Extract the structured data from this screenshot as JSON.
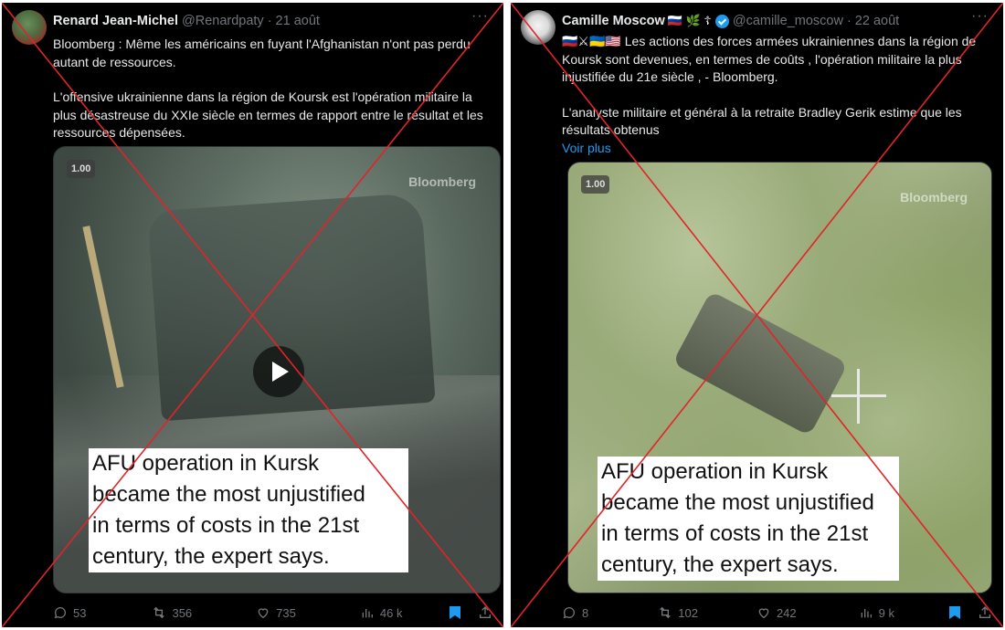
{
  "tweets": [
    {
      "author": "Renard Jean-Michel",
      "handle": "@Renardpaty",
      "separator": "·",
      "date": "21 août",
      "more": "···",
      "paragraph1": "Bloomberg : Même les américains en fuyant l'Afghanistan n'ont pas perdu autant de ressources.",
      "paragraph2": "L'offensive ukrainienne dans la région de Koursk est l'opération militaire la plus désastreuse du XXIe siècle en termes de rapport entre le résultat et les ressources dépensées.",
      "video": {
        "speed": "1.00",
        "watermark": "Bloomberg",
        "caption_lines": [
          "AFU operation in Kursk",
          "became the most unjustified",
          "in terms of costs in the 21st",
          "century, the expert says."
        ]
      },
      "stats": {
        "replies": "53",
        "reposts": "356",
        "likes": "735",
        "views": "46 k"
      }
    },
    {
      "author": "Camille Moscow",
      "name_emojis": "🇷🇺 🌿 ☦",
      "handle": "@camille_moscow",
      "separator": "·",
      "date": "22 août",
      "more": "···",
      "flags": "🇷🇺⚔🇺🇦🇺🇸",
      "paragraph1": "Les actions des forces armées ukrainiennes dans la région de Koursk sont devenues, en termes de coûts , l'opération militaire la plus injustifiée du 21e siècle , - Bloomberg.",
      "paragraph2": "L'analyste militaire et général à la retraite Bradley Gerik estime que les résultats obtenus",
      "read_more": "Voir plus",
      "video": {
        "speed": "1.00",
        "watermark": "Bloomberg",
        "caption_lines": [
          "AFU operation in Kursk",
          "became the most unjustified",
          "in terms of costs in the 21st",
          "century, the expert says."
        ]
      },
      "stats": {
        "replies": "8",
        "reposts": "102",
        "likes": "242",
        "views": "9 k"
      }
    }
  ],
  "colors": {
    "background": "#000000",
    "text": "#e7e9ea",
    "muted": "#71767b",
    "accent": "#1d9bf0",
    "cross": "#e0242a"
  },
  "icons": {
    "reply": "reply-icon",
    "repost": "repost-icon",
    "like": "like-icon",
    "views": "views-icon",
    "bookmark": "bookmark-icon",
    "share": "share-icon",
    "verified": "verified-icon",
    "play": "play-icon"
  }
}
